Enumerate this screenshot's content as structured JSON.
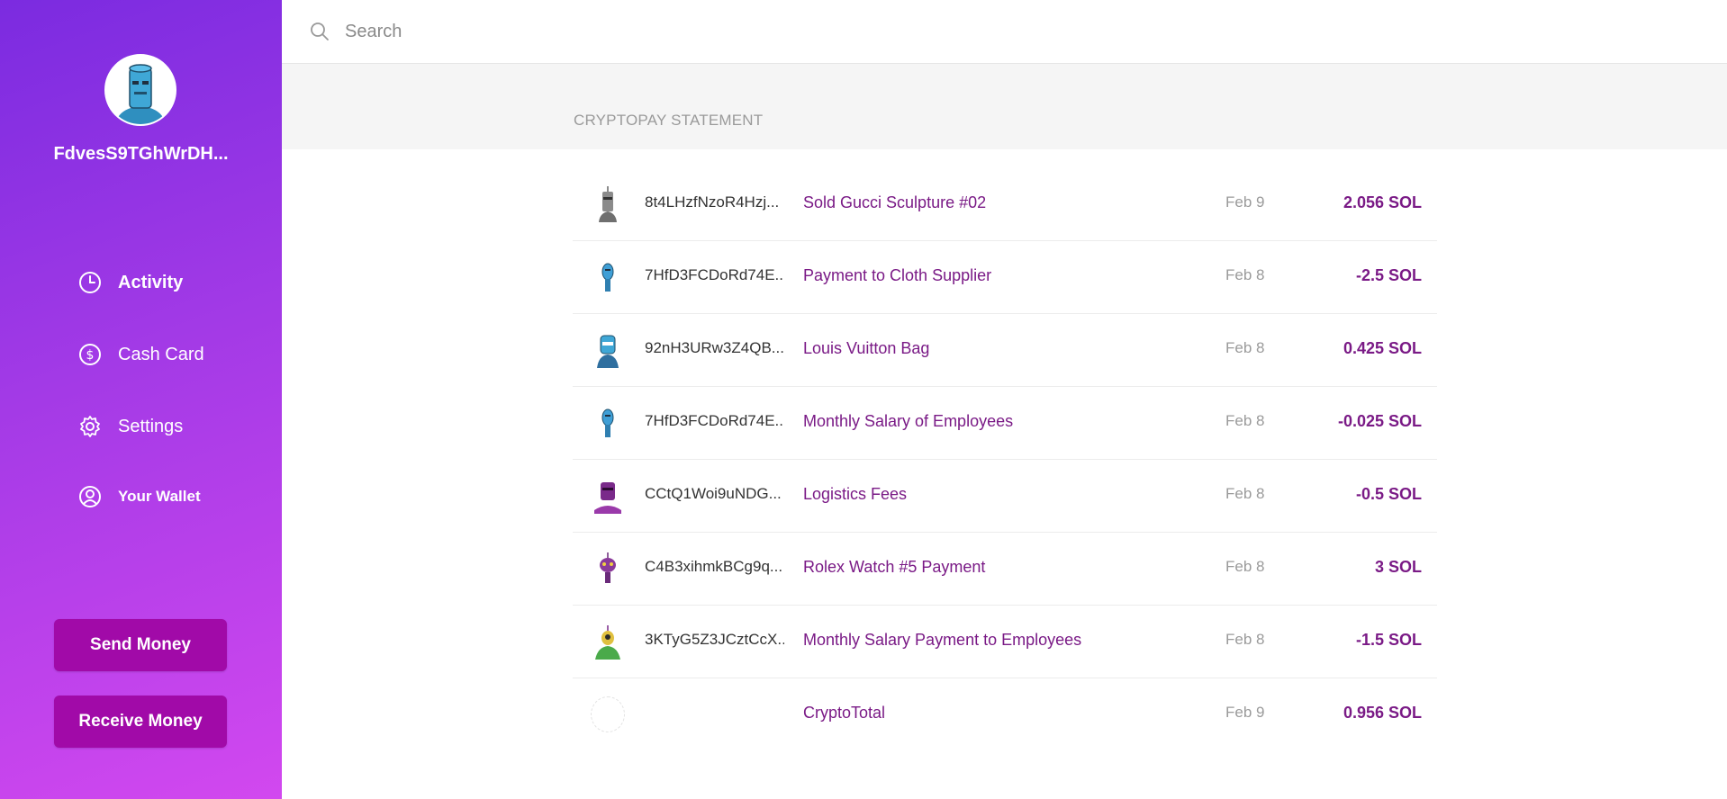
{
  "sidebar": {
    "username": "FdvesS9TGhWrDH...",
    "nav": [
      {
        "label": "Activity",
        "icon": "clock-icon"
      },
      {
        "label": "Cash Card",
        "icon": "dollar-circle-icon"
      },
      {
        "label": "Settings",
        "icon": "gear-icon"
      },
      {
        "label": "Your Wallet",
        "icon": "user-circle-icon"
      }
    ],
    "send_label": "Send Money",
    "receive_label": "Receive Money"
  },
  "search": {
    "placeholder": "Search",
    "value": ""
  },
  "statement": {
    "title": "CRYPTOPAY STATEMENT"
  },
  "transactions": [
    {
      "address": "8t4LHzfNzoR4Hzj...",
      "description": "Sold Gucci Sculpture #02",
      "date": "Feb 9",
      "amount": "2.056 SOL",
      "avatar": "gray-robot"
    },
    {
      "address": "7HfD3FCDoRd74E...",
      "description": "Payment to Cloth Supplier",
      "date": "Feb 8",
      "amount": "-2.5 SOL",
      "avatar": "blue-robot"
    },
    {
      "address": "92nH3URw3Z4QB...",
      "description": "Louis Vuitton Bag",
      "date": "Feb 8",
      "amount": "0.425 SOL",
      "avatar": "blue-helmet-robot"
    },
    {
      "address": "7HfD3FCDoRd74E...",
      "description": "Monthly Salary of Employees",
      "date": "Feb 8",
      "amount": "-0.025 SOL",
      "avatar": "blue-robot"
    },
    {
      "address": "CCtQ1Woi9uNDG...",
      "description": "Logistics Fees",
      "date": "Feb 8",
      "amount": "-0.5 SOL",
      "avatar": "purple-robot"
    },
    {
      "address": "C4B3xihmkBCg9q...",
      "description": "Rolex Watch #5 Payment",
      "date": "Feb 8",
      "amount": "3 SOL",
      "avatar": "purple-bug-robot"
    },
    {
      "address": "3KTyG5Z3JCztCcX...",
      "description": "Monthly Salary Payment to Employees",
      "date": "Feb 8",
      "amount": "-1.5 SOL",
      "avatar": "green-robot"
    },
    {
      "address": "",
      "description": "CryptoTotal",
      "date": "Feb 9",
      "amount": "0.956 SOL",
      "avatar": "blank"
    }
  ],
  "colors": {
    "sidebar_gradient_start": "#7b2be0",
    "sidebar_gradient_end": "#d248ef",
    "button": "#a10aa8",
    "accent_text": "#7a1a86"
  }
}
